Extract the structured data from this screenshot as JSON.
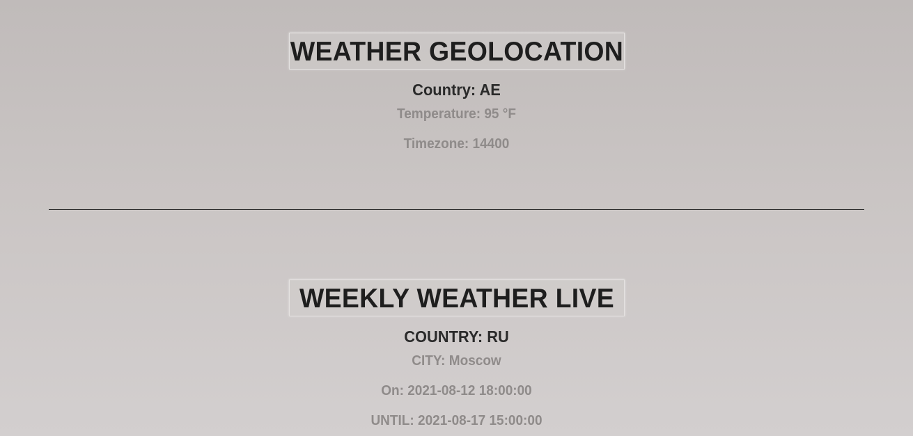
{
  "geolocation": {
    "title": "WEATHER GEOLOCATION",
    "country": "Country: AE",
    "temperature": "Temperature: 95 °F",
    "timezone": "Timezone: 14400"
  },
  "weekly": {
    "title": "WEEKLY WEATHER LIVE",
    "country": "COUNTRY: RU",
    "city": "CITY: Moscow",
    "on": "On: 2021-08-12 18:00:00",
    "until": "UNTIL: 2021-08-17 15:00:00"
  },
  "colors": {
    "title_text": "#1e1e1e",
    "primary_text": "#2a2a2a",
    "secondary_text": "#8f8b8a",
    "divider": "#1a1a1a"
  }
}
